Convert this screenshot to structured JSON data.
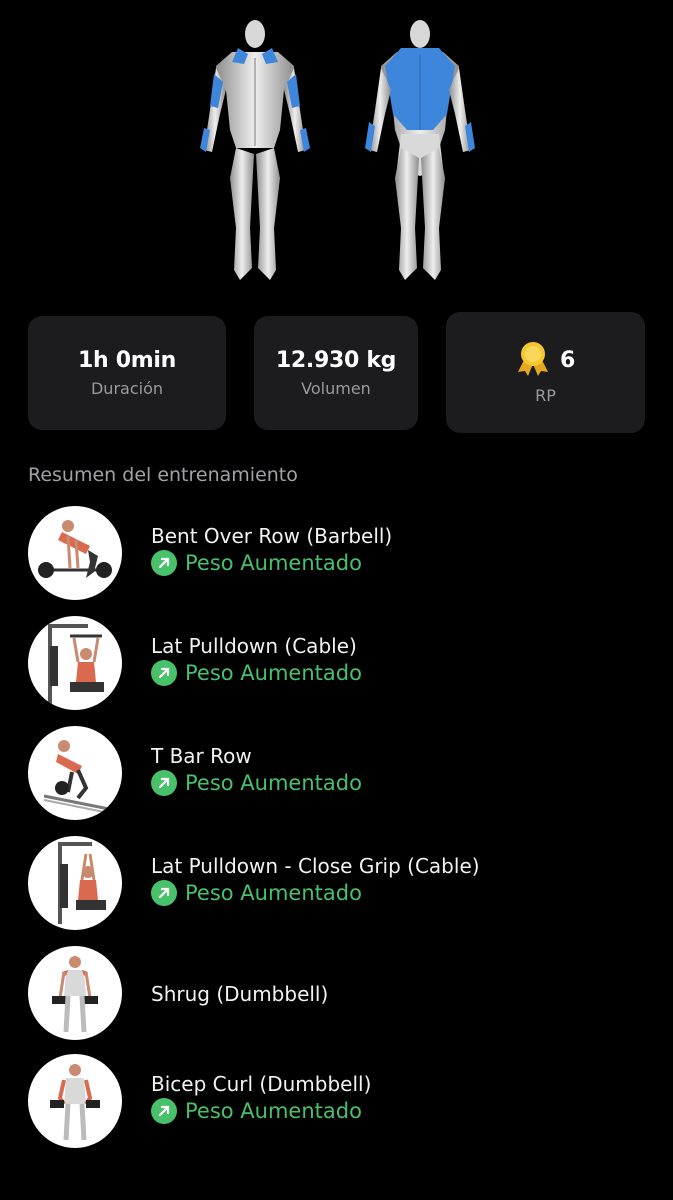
{
  "stats": {
    "duration": {
      "value": "1h 0min",
      "label": "Duración"
    },
    "volume": {
      "value": "12.930 kg",
      "label": "Volumen"
    },
    "records": {
      "value": "6",
      "label": "RP"
    }
  },
  "section_title": "Resumen del entrenamiento",
  "status_color": "#49c06a",
  "muscle_highlight_color": "#3d86dc",
  "exercises": [
    {
      "name": "Bent Over Row (Barbell)",
      "status": "Peso Aumentado"
    },
    {
      "name": "Lat Pulldown (Cable)",
      "status": "Peso Aumentado"
    },
    {
      "name": "T Bar Row",
      "status": "Peso Aumentado"
    },
    {
      "name": "Lat Pulldown - Close Grip (Cable)",
      "status": "Peso Aumentado"
    },
    {
      "name": "Shrug (Dumbbell)",
      "status": ""
    },
    {
      "name": "Bicep Curl (Dumbbell)",
      "status": "Peso Aumentado"
    }
  ]
}
